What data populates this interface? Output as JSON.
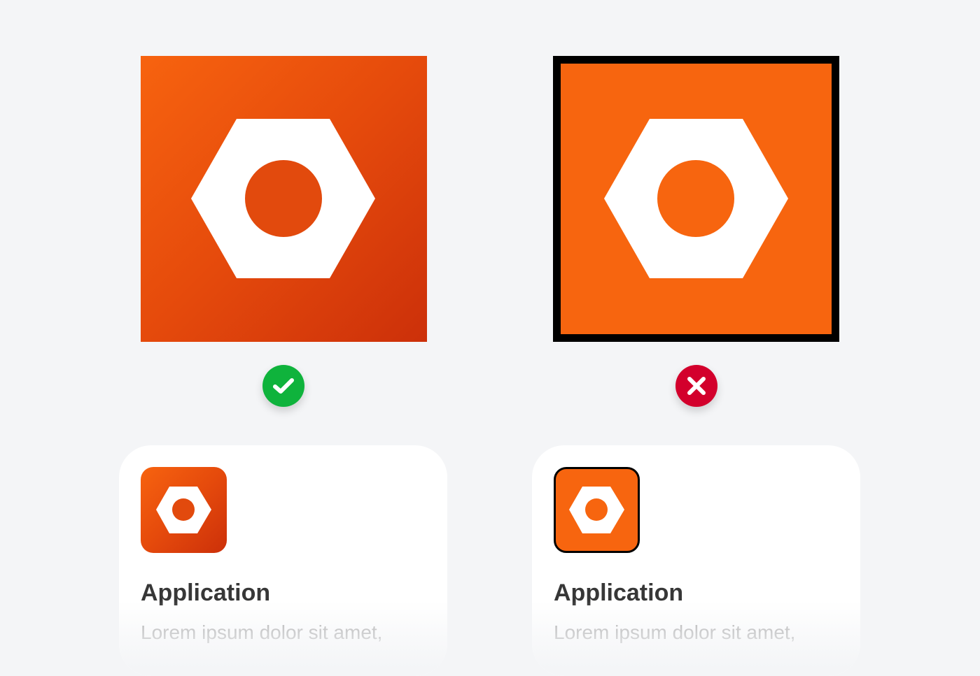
{
  "colors": {
    "background": "#f4f5f7",
    "icon_orange": "#f7650f",
    "icon_gradient_start": "#f7630f",
    "icon_gradient_end": "#cc300a",
    "border_black": "#000000",
    "success_green": "#0fb33c",
    "error_red": "#d3002c",
    "title_text": "#373737",
    "description_text": "#a4a4a4"
  },
  "examples": [
    {
      "verdict": "correct",
      "badge_icon": "checkmark-icon",
      "icon_style": "orange gradient, no border",
      "card": {
        "title": "Application",
        "description": "Lorem ipsum dolor sit amet,"
      }
    },
    {
      "verdict": "incorrect",
      "badge_icon": "cross-icon",
      "icon_style": "flat orange with black border",
      "card": {
        "title": "Application",
        "description": "Lorem ipsum dolor sit amet,"
      }
    }
  ]
}
